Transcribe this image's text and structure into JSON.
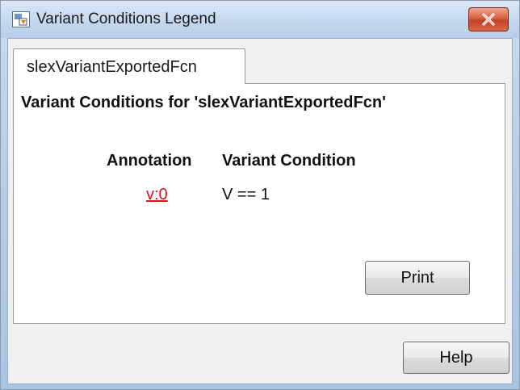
{
  "window": {
    "title": "Variant Conditions Legend"
  },
  "tabs": [
    {
      "label": "slexVariantExportedFcn"
    }
  ],
  "panel": {
    "heading": "Variant Conditions for 'slexVariantExportedFcn'",
    "columns": {
      "annotation": "Annotation",
      "condition": "Variant Condition"
    },
    "rows": [
      {
        "annotation": "v:0",
        "condition": "V == 1"
      }
    ],
    "print_label": "Print"
  },
  "footer": {
    "help_label": "Help"
  },
  "colors": {
    "link": "#e0101a",
    "close_button": "#c5402a",
    "title_bar": "#c4d8ef"
  },
  "icons": {
    "app": "simulink-window-icon",
    "close": "close-icon"
  }
}
